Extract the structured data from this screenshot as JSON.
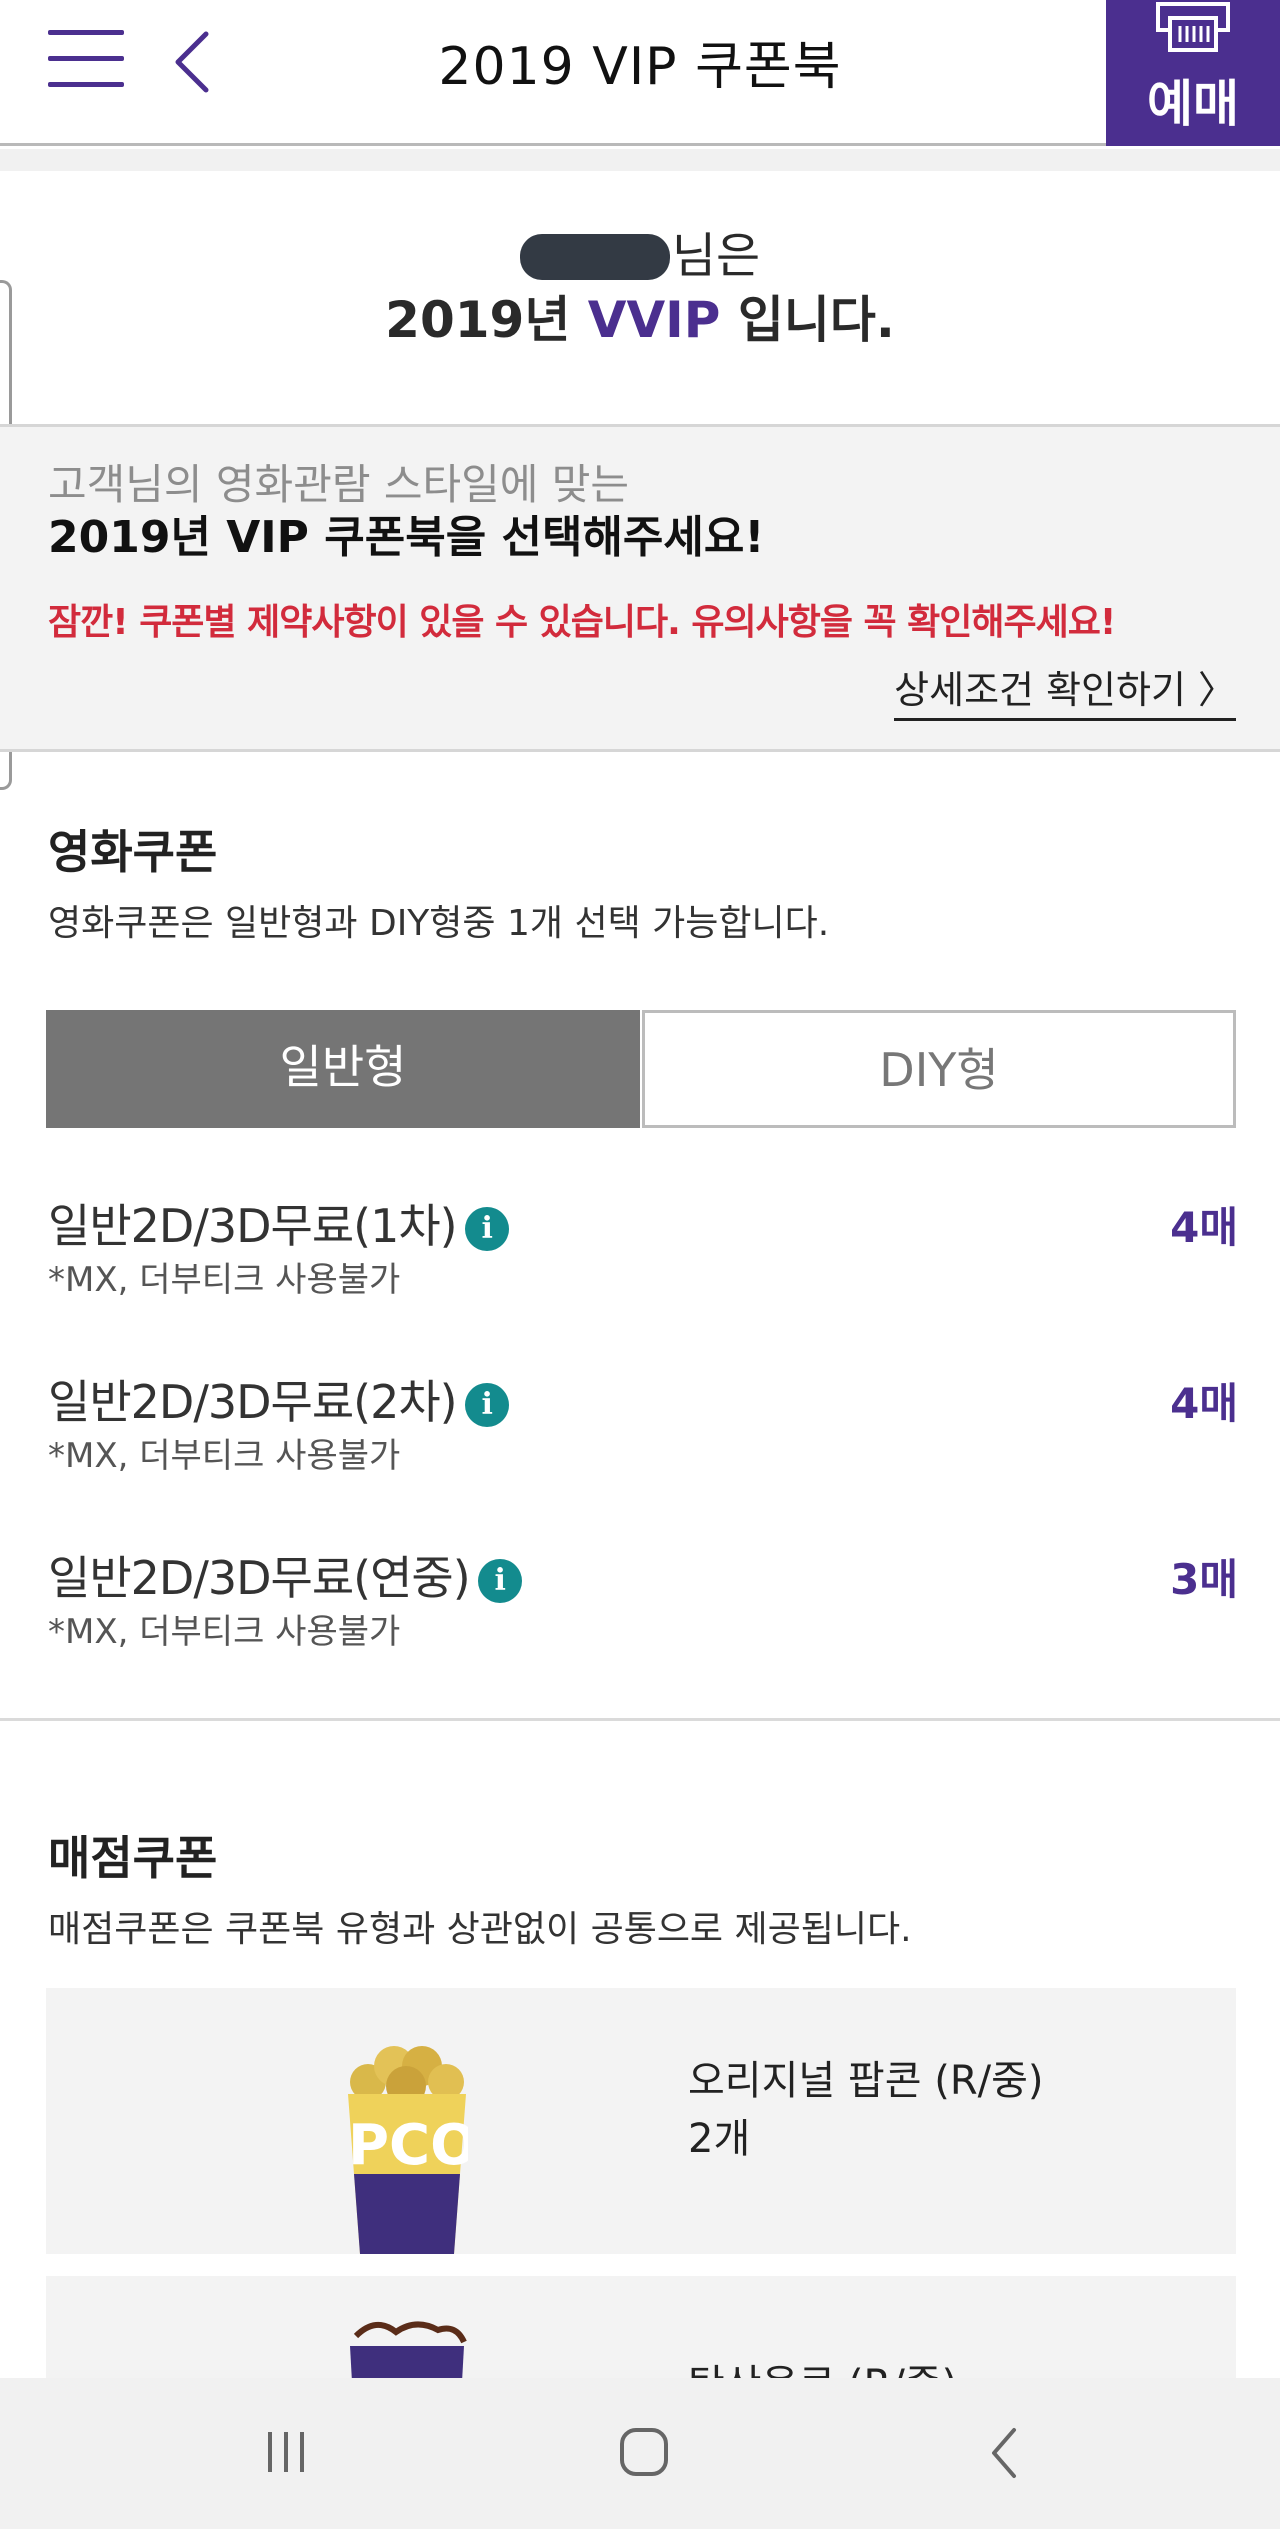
{
  "header": {
    "title": "2019 VIP 쿠폰북",
    "booking_label": "예매",
    "accent_color": "#4b2f8f"
  },
  "greeting": {
    "suffix": "님은",
    "line2_year": "2019년 ",
    "line2_grade": "VVIP",
    "line2_end": " 입니다."
  },
  "notice": {
    "subtitle": "고객님의 영화관람 스타일에 맞는",
    "title": "2019년 VIP 쿠폰북을 선택해주세요!",
    "warning": "잠깐! 쿠폰별 제약사항이 있을 수 있습니다. 유의사항을 꼭 확인해주세요!",
    "detail_link": "상세조건 확인하기 〉"
  },
  "movie_coupons": {
    "title": "영화쿠폰",
    "description": "영화쿠폰은 일반형과 DIY형중 1개 선택 가능합니다.",
    "tabs": [
      {
        "label": "일반형",
        "active": true
      },
      {
        "label": "DIY형",
        "active": false
      }
    ],
    "items": [
      {
        "name": "일반2D/3D무료(1차)",
        "note": "*MX, 더부티크 사용불가",
        "count": "4매"
      },
      {
        "name": "일반2D/3D무료(2차)",
        "note": "*MX, 더부티크 사용불가",
        "count": "4매"
      },
      {
        "name": "일반2D/3D무료(연중)",
        "note": "*MX, 더부티크 사용불가",
        "count": "3매"
      }
    ],
    "info_icon": "info-icon"
  },
  "store_coupons": {
    "title": "매점쿠폰",
    "description": "매점쿠폰은 쿠폰북 유형과 상관없이 공통으로 제공됩니다.",
    "items": [
      {
        "name": "오리지널 팝콘 (R/중)",
        "qty": "2개",
        "icon": "popcorn-icon"
      },
      {
        "name": "탄산음료 (R/중)",
        "icon": "soda-icon"
      }
    ]
  }
}
